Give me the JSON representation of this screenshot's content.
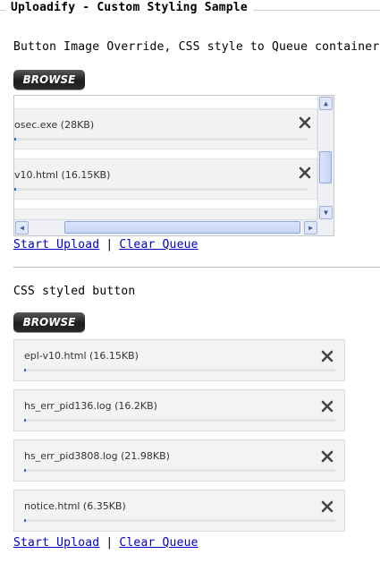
{
  "page_title": "Uploadify - Custom Styling Sample",
  "section1": {
    "heading": "Button Image Override, CSS style to Queue container",
    "browse_label": "BROWSE",
    "queue": [
      {
        "file": "osec.exe (28KB)",
        "progress": 0
      },
      {
        "file": "v10.html (16.15KB)",
        "progress": 0
      }
    ],
    "start_upload": "Start Upload",
    "separator": "|",
    "clear_queue": "Clear Queue"
  },
  "section2": {
    "heading": "CSS styled button",
    "browse_label": "BROWSE",
    "queue": [
      {
        "file": "epl-v10.html (16.15KB)",
        "progress": 0
      },
      {
        "file": "hs_err_pid136.log (16.2KB)",
        "progress": 0
      },
      {
        "file": "hs_err_pid3808.log (21.98KB)",
        "progress": 0
      },
      {
        "file": "notice.html (6.35KB)",
        "progress": 0
      }
    ],
    "start_upload": "Start Upload",
    "separator": "|",
    "clear_queue": "Clear Queue"
  },
  "icons": {
    "remove": "close-icon",
    "scroll_up": "arrow-up-icon",
    "scroll_down": "arrow-down-icon",
    "scroll_left": "arrow-left-icon",
    "scroll_right": "arrow-right-icon"
  },
  "colors": {
    "link": "#0000cc",
    "progress_fill": "#2d6ad6",
    "button_dark": "#1e1e1e",
    "queue_item_bg": "#f3f3f3"
  }
}
